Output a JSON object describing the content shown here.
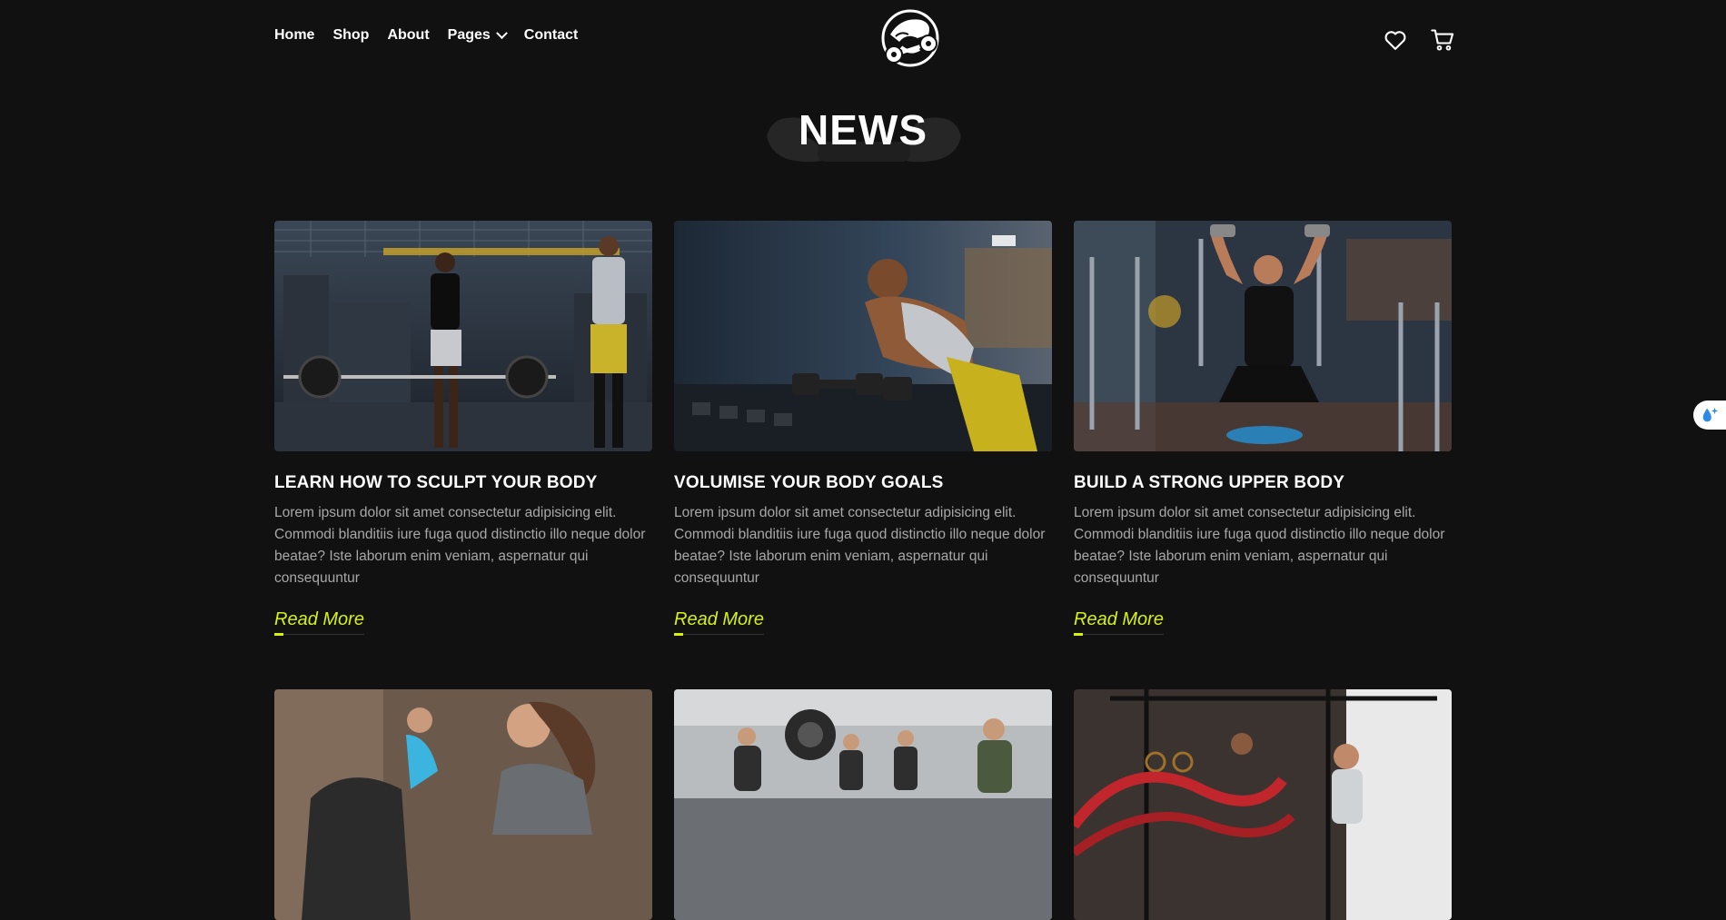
{
  "header": {
    "nav": [
      {
        "label": "Home"
      },
      {
        "label": "Shop"
      },
      {
        "label": "About"
      },
      {
        "label": "Pages"
      },
      {
        "label": "Contact"
      }
    ],
    "logo_icon": "gorilla-barbell-logo-icon",
    "icons": [
      "heart-icon",
      "cart-icon"
    ]
  },
  "section": {
    "title": "NEWS"
  },
  "cards": [
    {
      "title": "LEARN HOW TO SCULPT YOUR BODY",
      "text": "Lorem ipsum dolor sit amet consectetur adipisicing elit. Commodi blanditiis iure fuga quod distinctio illo neque dolor beatae? Iste laborum enim veniam, aspernatur qui consequuntur",
      "link": "Read More"
    },
    {
      "title": "VOLUMISE YOUR BODY GOALS",
      "text": "Lorem ipsum dolor sit amet consectetur adipisicing elit. Commodi blanditiis iure fuga quod distinctio illo neque dolor beatae? Iste laborum enim veniam, aspernatur qui consequuntur",
      "link": "Read More"
    },
    {
      "title": "BUILD A STRONG UPPER BODY",
      "text": "Lorem ipsum dolor sit amet consectetur adipisicing elit. Commodi blanditiis iure fuga quod distinctio illo neque dolor beatae? Iste laborum enim veniam, aspernatur qui consequuntur",
      "link": "Read More"
    }
  ],
  "colors": {
    "background": "#111111",
    "accent": "#d7f20a",
    "text_muted": "#a8a8a8"
  }
}
